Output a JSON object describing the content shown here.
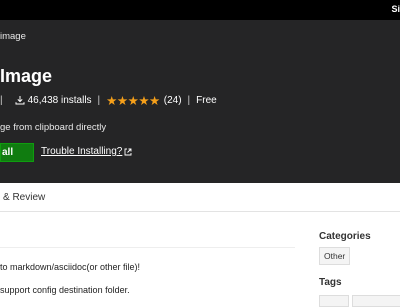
{
  "header": {
    "signin_label": "Si"
  },
  "hero": {
    "breadcrumb": "image",
    "title": "Image",
    "installs": "46,438 installs",
    "rating": 5,
    "rating_count": "(24)",
    "price": "Free",
    "tagline": "ge from clipboard directly",
    "install_label": "all",
    "trouble_label": "Trouble Installing?",
    "star_color": "#f6a01a",
    "install_color": "#107c10"
  },
  "tabs": {
    "rating_review": "& Review"
  },
  "content": {
    "line1": "to markdown/asciidoc(or other file)!",
    "line2": "support config destination folder."
  },
  "sidebar": {
    "categories_heading": "Categories",
    "category_other": "Other",
    "tags_heading": "Tags"
  },
  "icons": [
    "download-icon",
    "star-icon",
    "external-link-icon"
  ]
}
